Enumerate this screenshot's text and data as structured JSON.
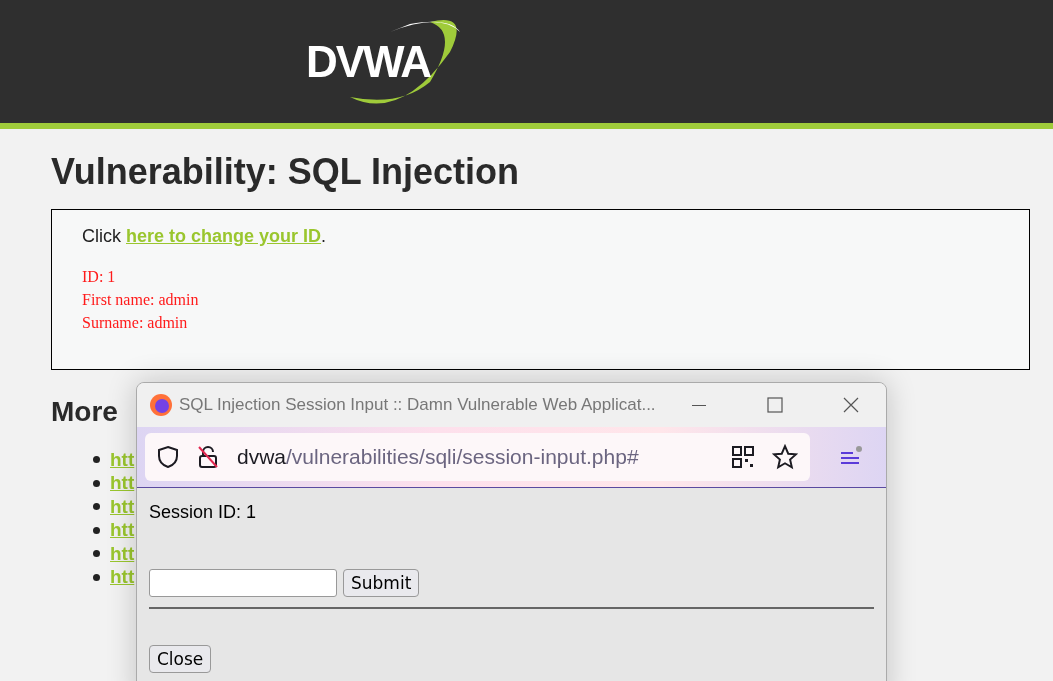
{
  "header": {
    "logo": "DVWA"
  },
  "title": "Vulnerability: SQL Injection",
  "box": {
    "prefix": "Click ",
    "link": "here to change your ID",
    "suffix": ".",
    "output": [
      "ID: 1",
      "First name: admin",
      "Surname: admin"
    ]
  },
  "more": {
    "heading": "More",
    "links": [
      "htt",
      "htt",
      "htt",
      "htt",
      "htt",
      "htt"
    ]
  },
  "popup": {
    "title": "SQL Injection Session Input :: Damn Vulnerable Web Applicat...",
    "url_host": "dvwa",
    "url_path": "/vulnerabilities/sqli/session-input.php#",
    "session": "Session ID: 1",
    "submit": "Submit",
    "close": "Close"
  }
}
